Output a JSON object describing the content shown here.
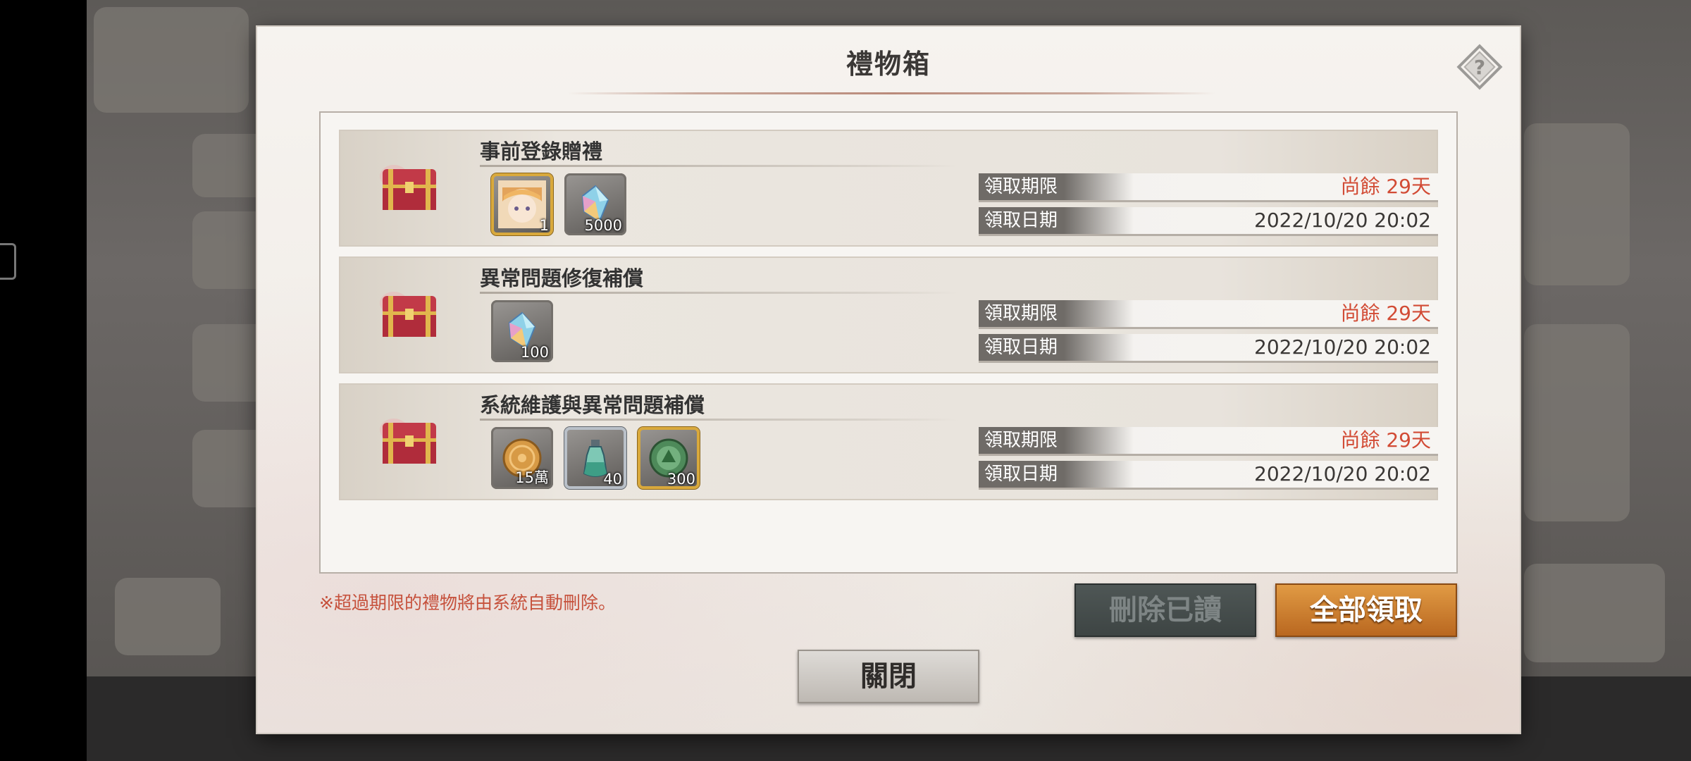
{
  "dialog": {
    "title": "禮物箱",
    "note": "※超過期限的禮物將由系統自動刪除。",
    "buttons": {
      "delete_read": "刪除已讀",
      "claim_all": "全部領取",
      "close": "關閉"
    }
  },
  "gifts": [
    {
      "title": "事前登錄贈禮",
      "items": [
        {
          "icon": "character-portrait-icon",
          "qty": "1",
          "frame": "gold"
        },
        {
          "icon": "crystal-gem-icon",
          "qty": "5000",
          "frame": "plain"
        }
      ],
      "deadline_label": "領取期限",
      "deadline_value": "尚餘 29天",
      "date_label": "領取日期",
      "date_value": "2022/10/20 20:02"
    },
    {
      "title": "異常問題修復補償",
      "items": [
        {
          "icon": "crystal-gem-icon",
          "qty": "100",
          "frame": "plain"
        }
      ],
      "deadline_label": "領取期限",
      "deadline_value": "尚餘 29天",
      "date_label": "領取日期",
      "date_value": "2022/10/20 20:02"
    },
    {
      "title": "系統維護與異常問題補償",
      "items": [
        {
          "icon": "gold-coin-icon",
          "qty": "15萬",
          "frame": "plain"
        },
        {
          "icon": "potion-bottle-icon",
          "qty": "40",
          "frame": "silver"
        },
        {
          "icon": "green-medal-icon",
          "qty": "300",
          "frame": "gold"
        }
      ],
      "deadline_label": "領取期限",
      "deadline_value": "尚餘 29天",
      "date_label": "領取日期",
      "date_value": "2022/10/20 20:02"
    }
  ],
  "colors": {
    "accent_red": "#d24b35",
    "claim_button": "#d08a3a",
    "delete_button": "#464d4c"
  }
}
